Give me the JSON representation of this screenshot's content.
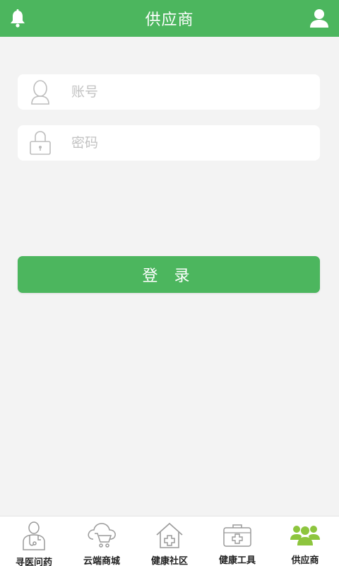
{
  "header": {
    "title": "供应商",
    "left_icon": "bell-icon",
    "right_icon": "user-icon"
  },
  "form": {
    "account_placeholder": "账号",
    "account_icon": "user-outline-icon",
    "password_placeholder": "密码",
    "password_icon": "lock-icon",
    "login_label": "登 录"
  },
  "tabbar": {
    "items": [
      {
        "label": "寻医问药",
        "icon": "doctor-icon",
        "active": false
      },
      {
        "label": "云端商城",
        "icon": "cloud-cart-icon",
        "active": false
      },
      {
        "label": "健康社区",
        "icon": "house-cross-icon",
        "active": false
      },
      {
        "label": "健康工具",
        "icon": "medical-kit-icon",
        "active": false
      },
      {
        "label": "供应商",
        "icon": "group-icon",
        "active": true
      }
    ]
  },
  "colors": {
    "accent": "#4cb65e",
    "active_tab_icon": "#8dc53e",
    "inactive_tab_icon": "#9a9a9a",
    "background": "#f3f3f3"
  }
}
